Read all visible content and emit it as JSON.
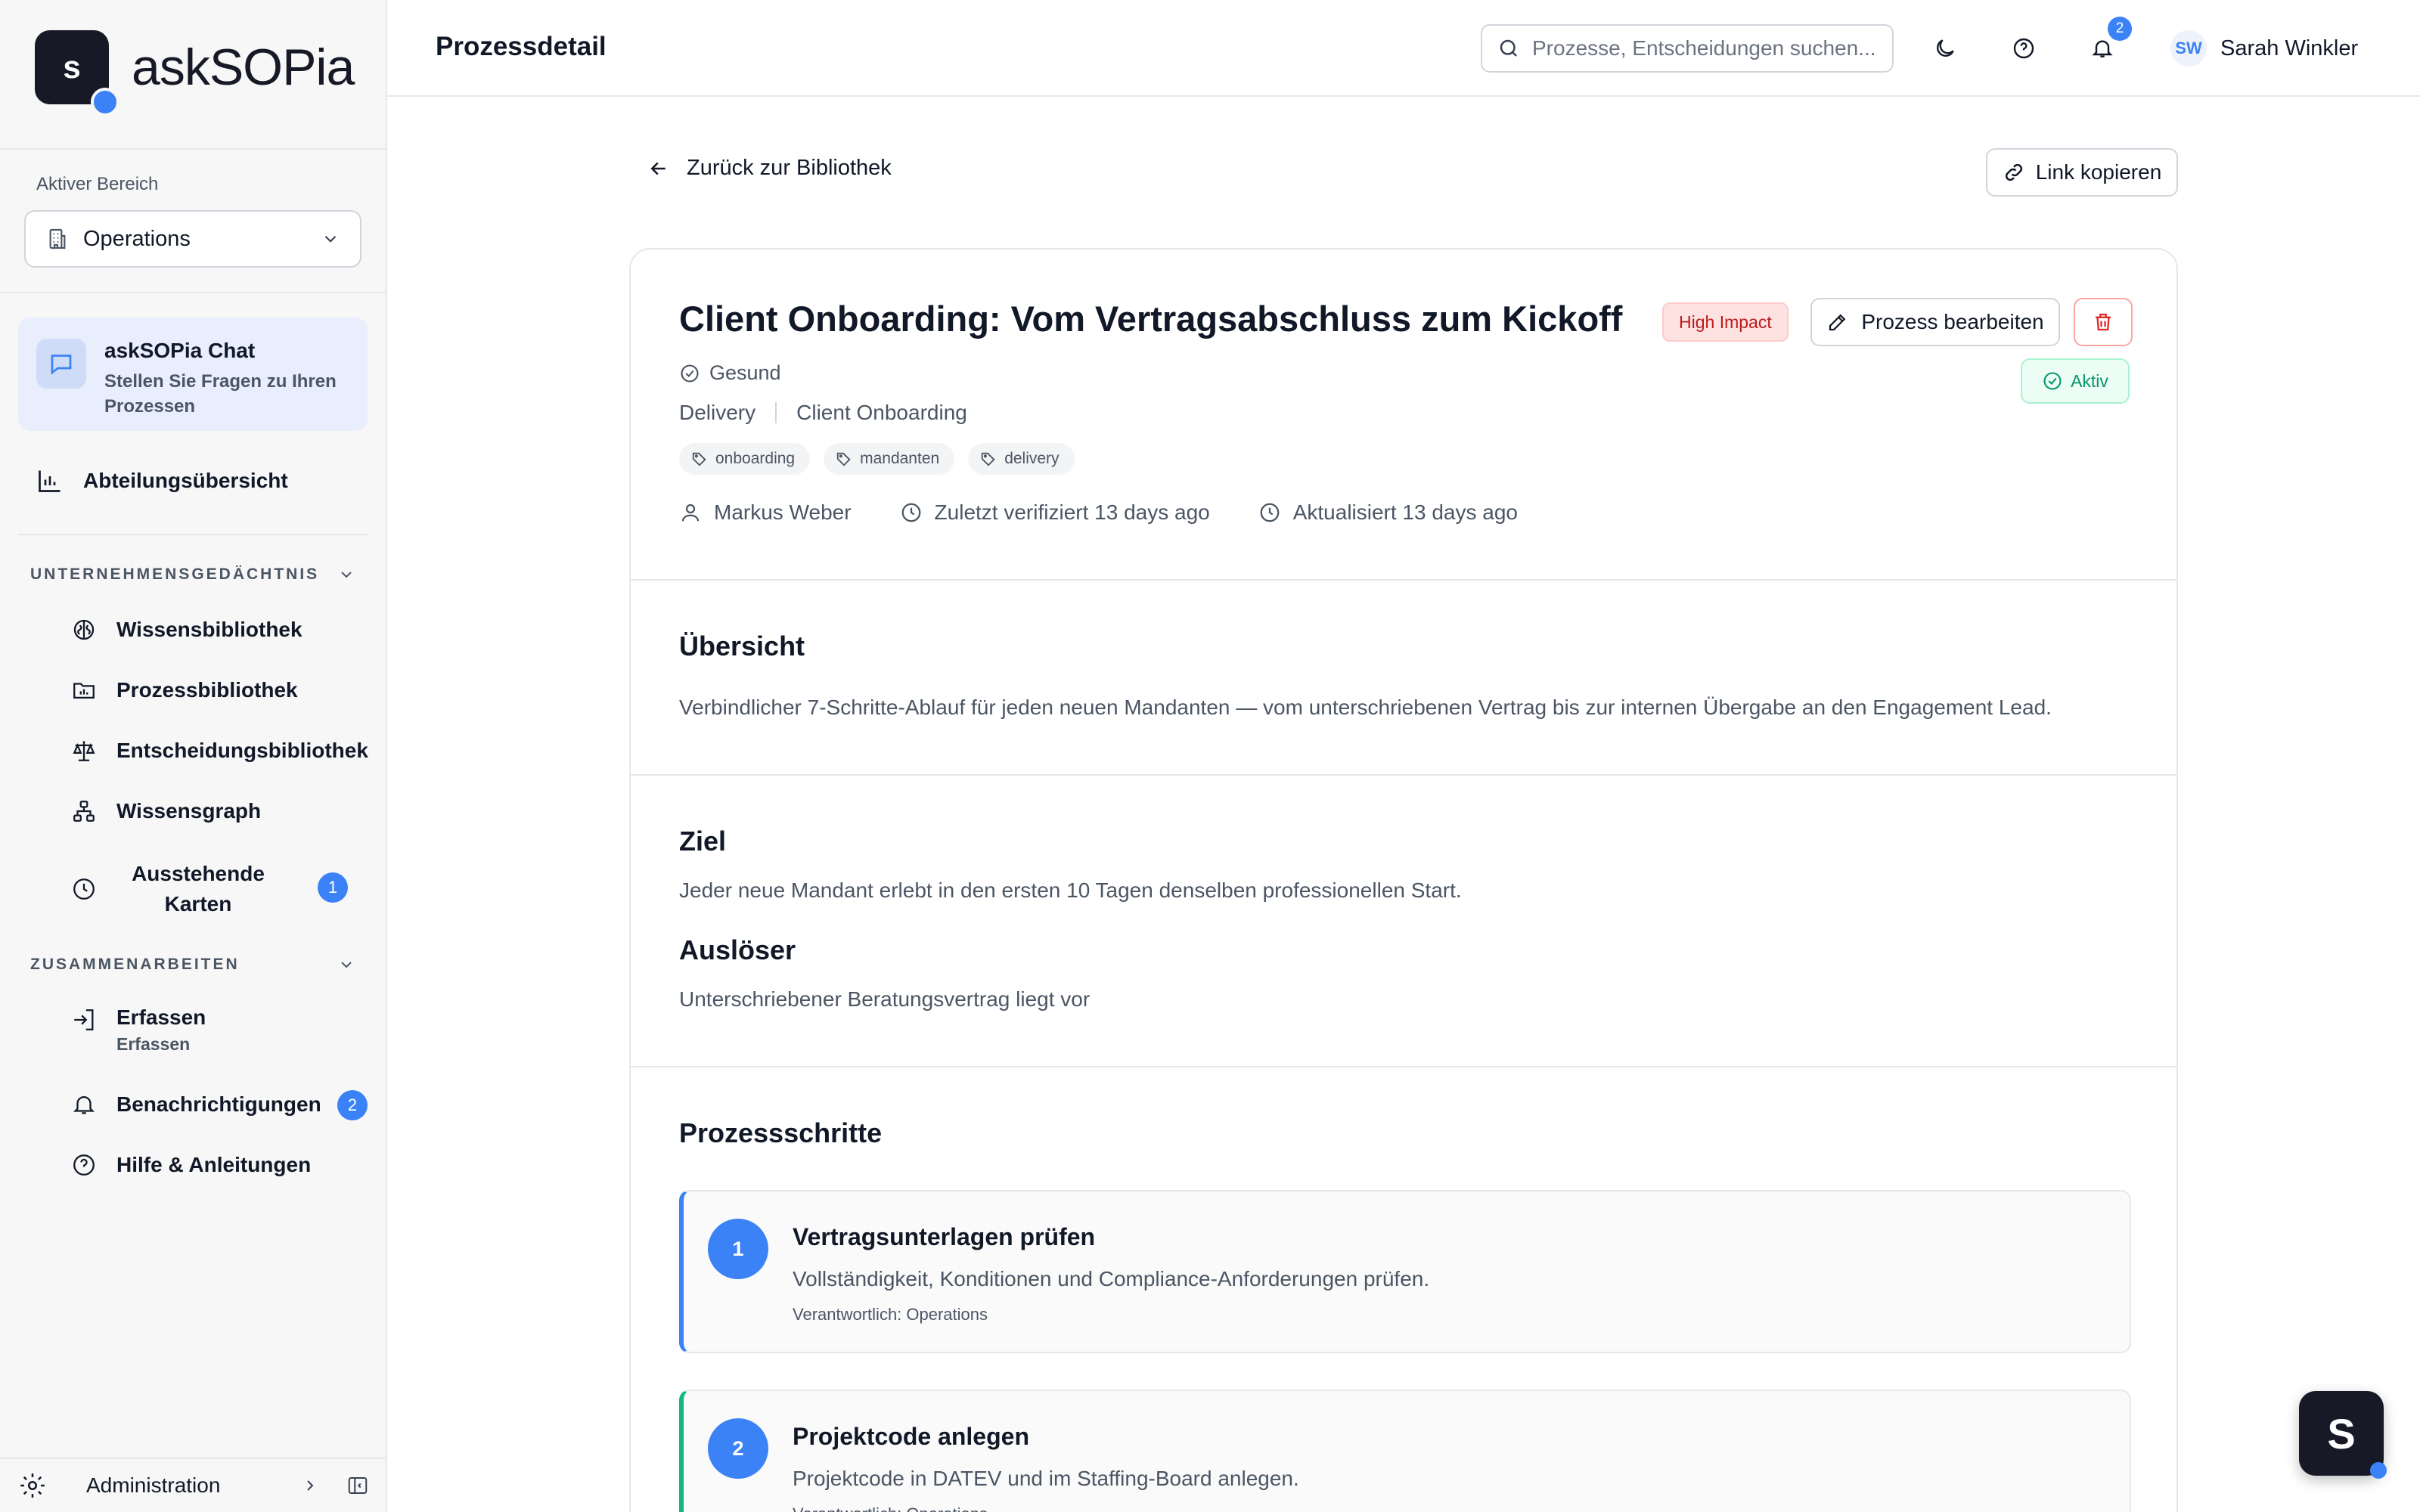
{
  "brand": {
    "mark": "s",
    "name_part1": "ask",
    "name_part2": "SOPia"
  },
  "sidebar": {
    "area_label": "Aktiver Bereich",
    "area_value": "Operations",
    "chat": {
      "title": "askSOPia Chat",
      "subtitle": "Stellen Sie Fragen zu Ihren Prozessen"
    },
    "overview": "Abteilungsübersicht",
    "section1": "UNTERNEHMENSGEDÄCHTNIS",
    "items1": [
      {
        "label": "Wissensbibliothek"
      },
      {
        "label": "Prozessbibliothek"
      },
      {
        "label": "Entscheidungsbibliothek"
      },
      {
        "label": "Wissensgraph"
      },
      {
        "label": "Ausstehende Karten",
        "badge": "1"
      }
    ],
    "section2": "ZUSAMMENARBEITEN",
    "items2": [
      {
        "label": "Erfassen",
        "sub": "Erfassen"
      },
      {
        "label": "Benachrichtigungen",
        "badge": "2"
      },
      {
        "label": "Hilfe & Anleitungen"
      }
    ],
    "admin": "Administration"
  },
  "header": {
    "title": "Prozessdetail",
    "search_placeholder": "Prozesse, Entscheidungen suchen...",
    "notif_count": "2",
    "user_initials": "SW",
    "user_name": "Sarah Winkler"
  },
  "main": {
    "back_label": "Zurück zur Bibliothek",
    "copy_link": "Link kopieren",
    "process": {
      "title": "Client Onboarding: Vom Vertragsabschluss zum Kickoff",
      "impact": "High Impact",
      "edit_label": "Prozess bearbeiten",
      "health": "Gesund",
      "status": "Aktiv",
      "department": "Delivery",
      "category": "Client Onboarding",
      "tags": [
        "onboarding",
        "mandanten",
        "delivery"
      ],
      "owner": "Markus Weber",
      "verified": "Zuletzt verifiziert 13 days ago",
      "updated": "Aktualisiert 13 days ago"
    },
    "overview_title": "Übersicht",
    "overview_text": "Verbindlicher 7-Schritte-Ablauf für jeden neuen Mandanten — vom unterschriebenen Vertrag bis zur internen Übergabe an den Engagement Lead.",
    "goal_title": "Ziel",
    "goal_text": "Jeder neue Mandant erlebt in den ersten 10 Tagen denselben professionellen Start.",
    "trigger_title": "Auslöser",
    "trigger_text": "Unterschriebener Beratungsvertrag liegt vor",
    "steps_title": "Prozessschritte",
    "steps": [
      {
        "num": "1",
        "title": "Vertragsunterlagen prüfen",
        "desc": "Vollständigkeit, Konditionen und Compliance-Anforderungen prüfen.",
        "resp": "Verantwortlich: Operations"
      },
      {
        "num": "2",
        "title": "Projektcode anlegen",
        "desc": "Projektcode in DATEV und im Staffing-Board anlegen.",
        "resp": "Verantwortlich: Operations"
      }
    ]
  },
  "fab": {
    "label": "S"
  },
  "colors": {
    "accent": "#3b82f6",
    "brand_dark": "#171a26",
    "danger": "#b91c1c",
    "success": "#059669"
  }
}
